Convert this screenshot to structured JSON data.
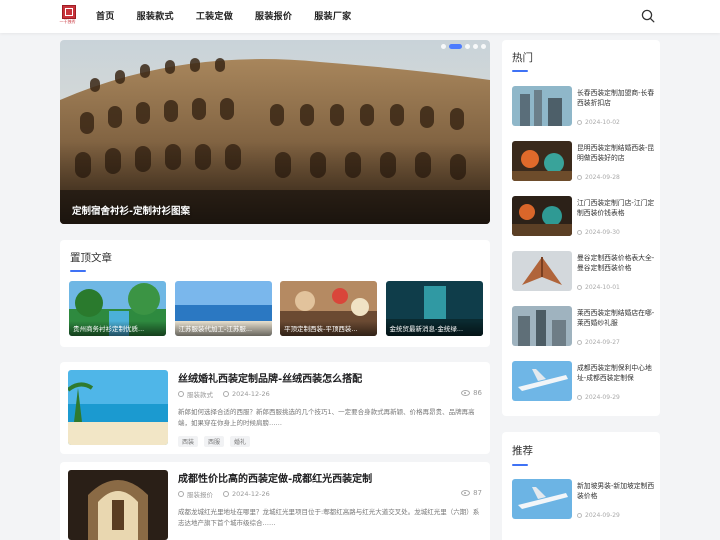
{
  "header": {
    "logo_text": "一干独秀",
    "nav": [
      "首页",
      "服装款式",
      "工装定做",
      "服装报价",
      "服装厂家"
    ]
  },
  "hero": {
    "caption": "定制宿舍衬衫-定制衬衫图案"
  },
  "pinned": {
    "title": "置顶文章",
    "items": [
      {
        "caption": "贵州商务衬衫定制优质..."
      },
      {
        "caption": "江苏服装代加工-江苏服..."
      },
      {
        "caption": "平顶定制西装-平顶西装..."
      },
      {
        "caption": "金统贸最新消息-金统绿..."
      }
    ]
  },
  "articles": [
    {
      "title": "丝绒婚礼西装定制品牌-丝绒西装怎么搭配",
      "category": "服装款式",
      "date": "2024-12-26",
      "views": "86",
      "excerpt": "新郎如何选择合适的西服？新郎西服挑选的几个技巧1、一定要合身款式再新颖、价格再昂贵、品牌再高端，如果穿在你身上的时候肩膀……",
      "tags": [
        "西装",
        "西服",
        "婚礼"
      ]
    },
    {
      "title": "成都性价比高的西装定做-成都红光西装定制",
      "category": "服装报价",
      "date": "2024-12-26",
      "views": "87",
      "excerpt": "成都龙城红光里地址在哪里？龙城红光里项目位于:郫都红高路与红光大道交叉处。龙城红光里（六期）系志达地产旗下首个城市级综合……",
      "tags": []
    }
  ],
  "sidebar": {
    "hot_title": "热门",
    "hot": [
      {
        "title": "长春西装定制加盟商-长春西装折扣店",
        "date": "2024-10-02"
      },
      {
        "title": "昆明西装定制结婚西装-昆明做西装好的店",
        "date": "2024-09-28"
      },
      {
        "title": "江门西装定制门店-江门定制西装价钱表格",
        "date": "2024-09-30"
      },
      {
        "title": "曼谷定制西装价格表大全-曼谷定制西装价格",
        "date": "2024-10-01"
      },
      {
        "title": "莱西西装定制结婚店在哪-莱西婚纱礼服",
        "date": "2024-09-27"
      },
      {
        "title": "成都西装定制保利中心地址-成都西装定制保",
        "date": "2024-09-29"
      }
    ],
    "recommend_title": "推荐",
    "recommend": [
      {
        "title": "新加坡男装-新加坡定制西装价格",
        "date": "2024-09-29"
      }
    ]
  }
}
